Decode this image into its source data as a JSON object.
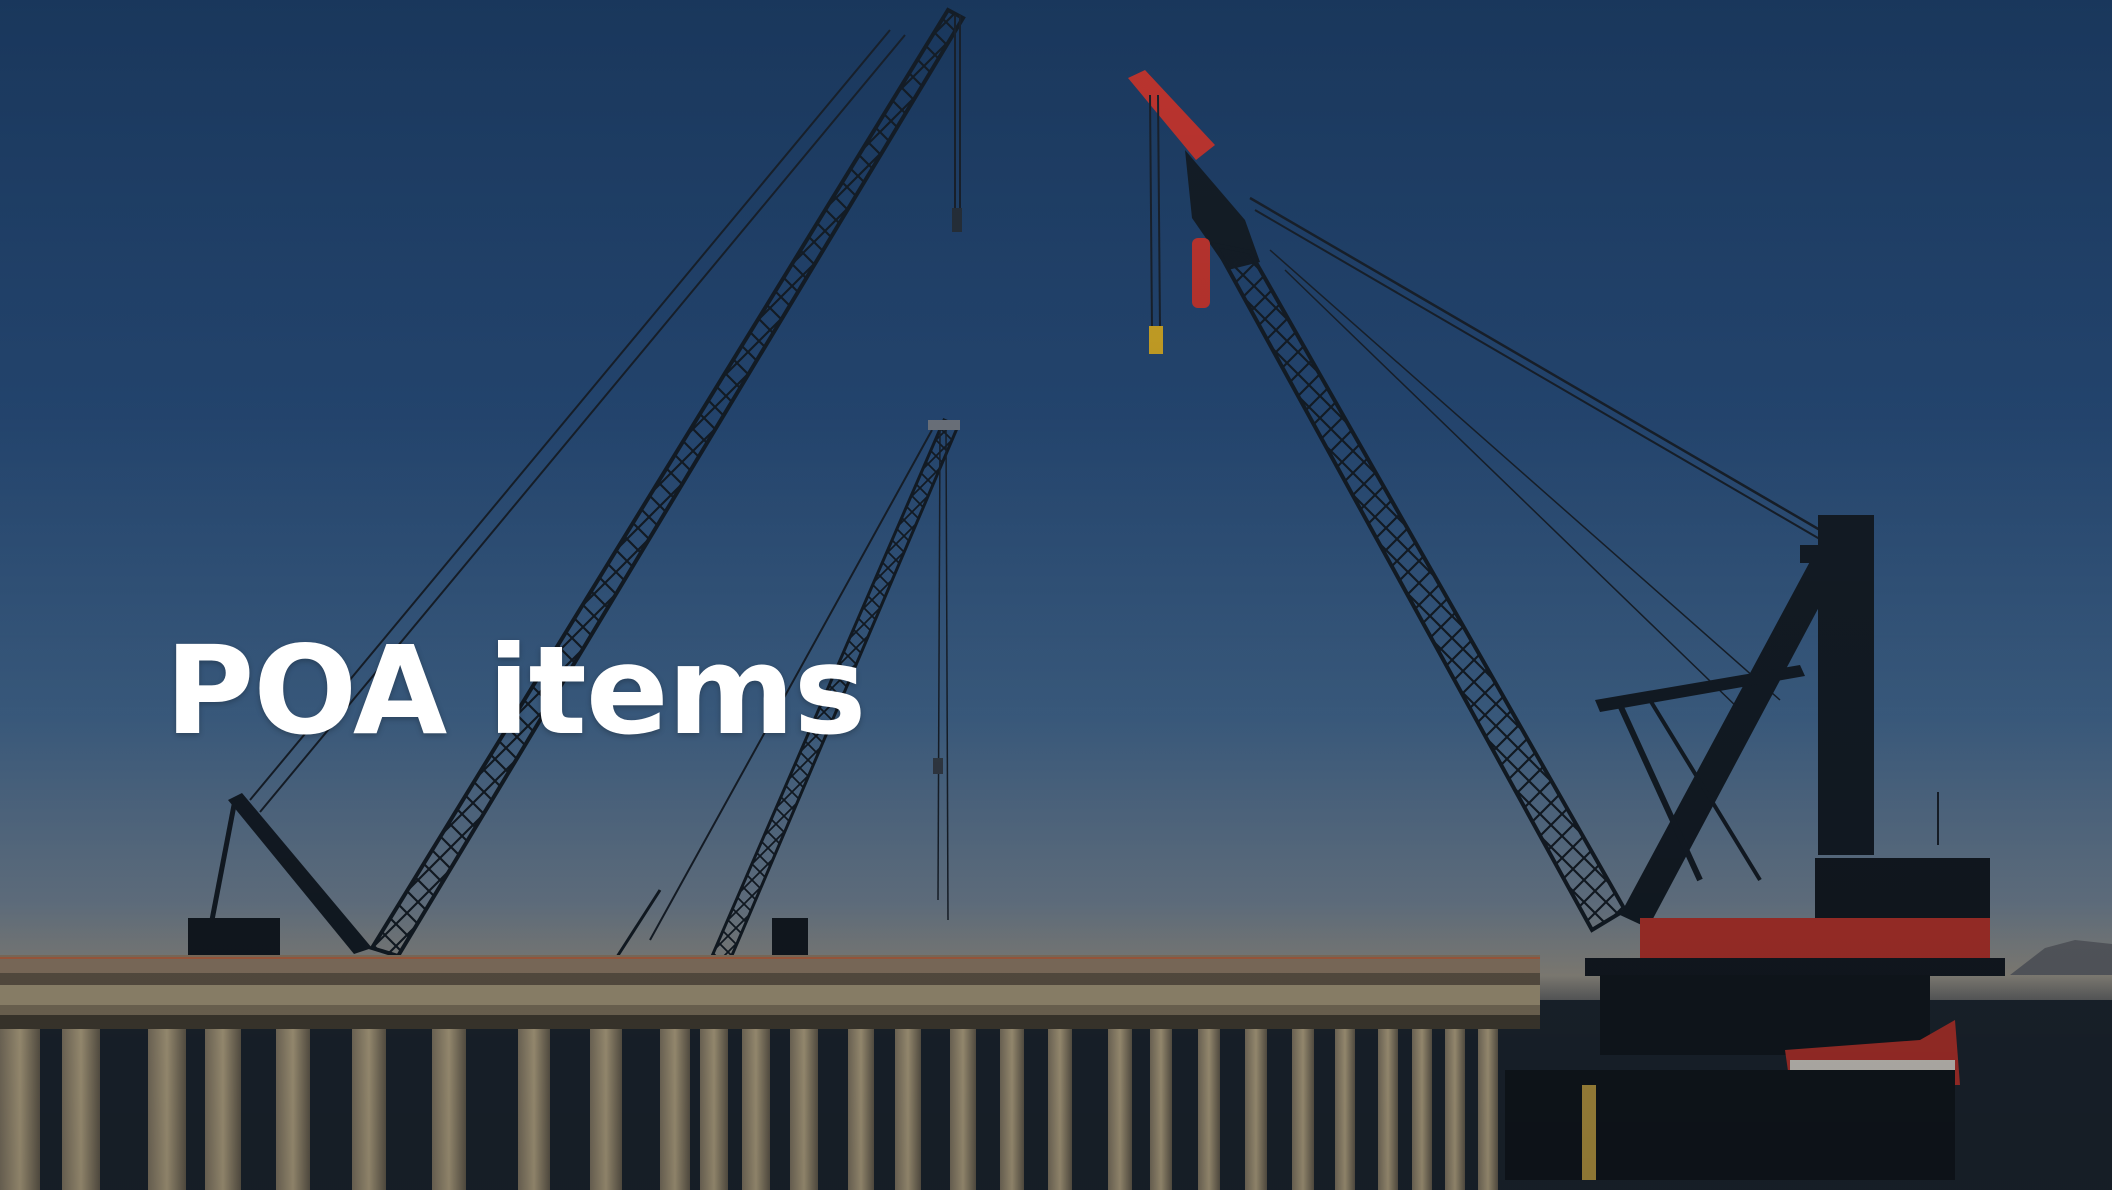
{
  "slide": {
    "title": "POA items"
  },
  "photo": {
    "subject": "construction-cranes-on-pier",
    "colors": {
      "sky_top": "#1c3d66",
      "sky_horizon": "#a5a197",
      "steel": "#16202b",
      "crane_red": "#d03a34",
      "pier_concrete": "#b7a98a",
      "water": "#1f2a36"
    }
  }
}
